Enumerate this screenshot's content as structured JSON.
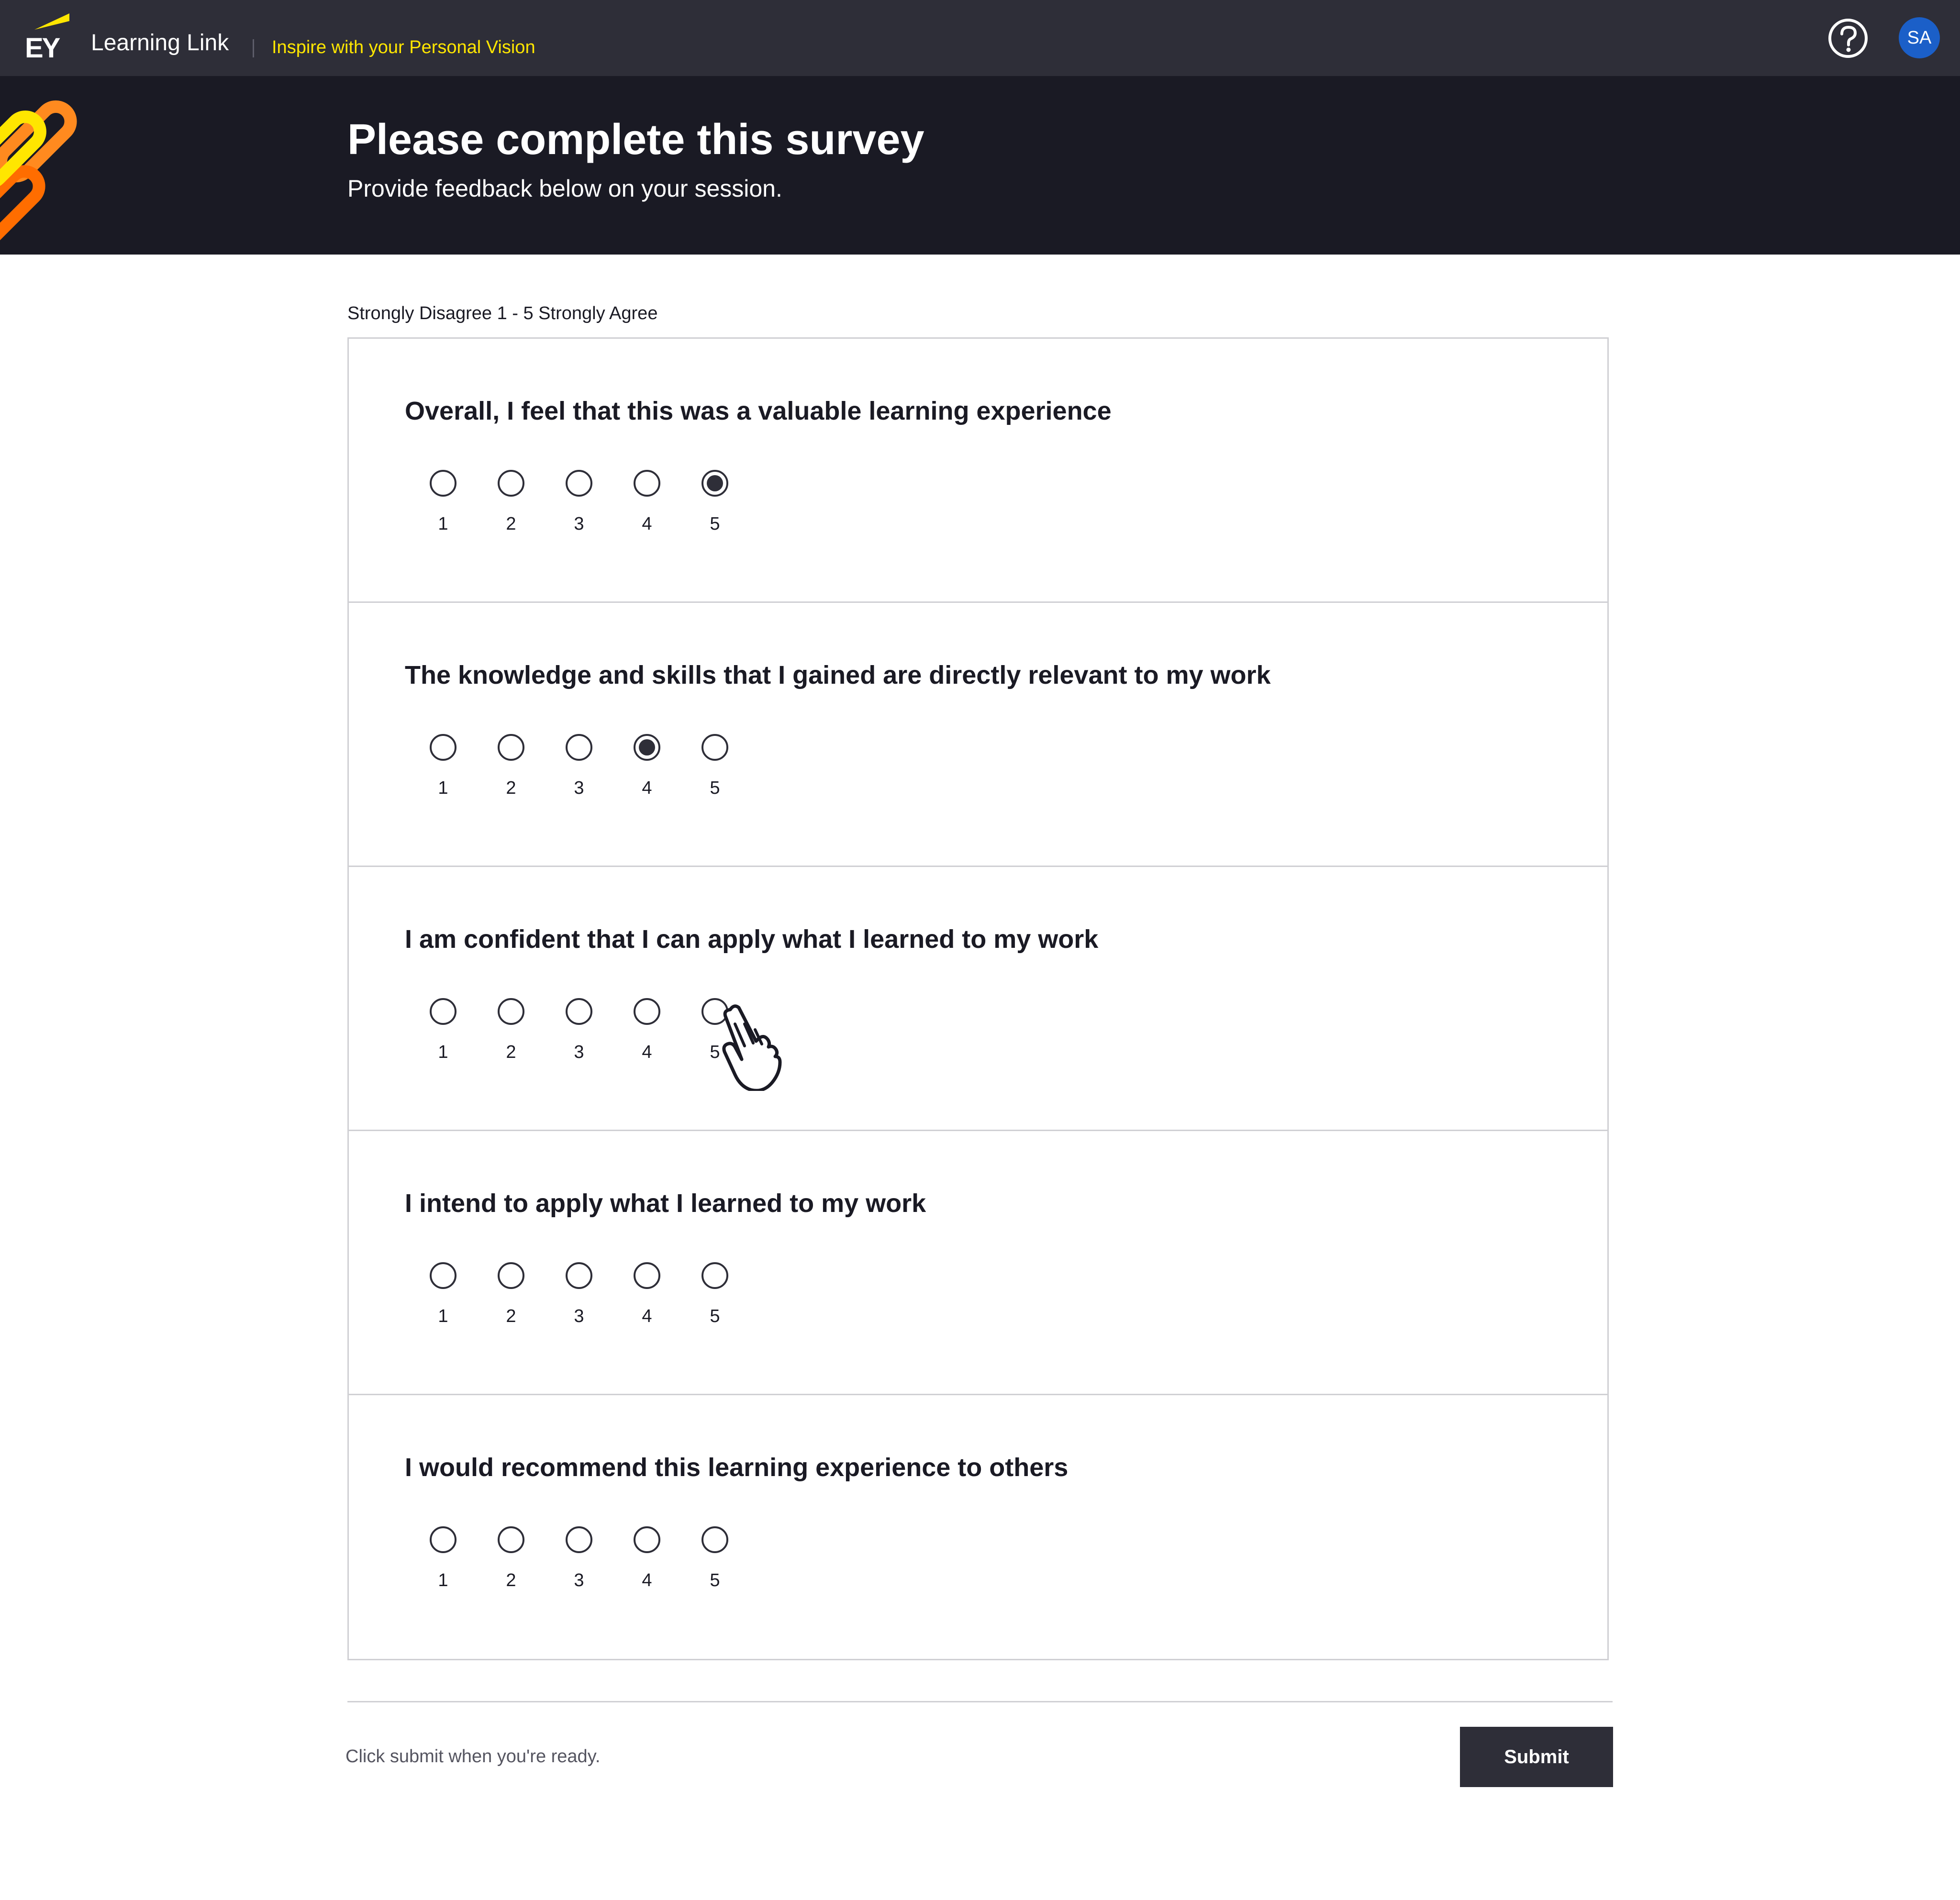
{
  "header": {
    "brand_logo_text": "EY",
    "app_name": "Learning Link",
    "tagline": "Inspire with your Personal Vision",
    "help_icon": "question-circle-icon",
    "avatar_initials": "SA",
    "colors": {
      "bar": "#2e2e38",
      "tagline": "#ffe600",
      "avatar": "#1b5fc8"
    }
  },
  "hero": {
    "title": "Please complete this survey",
    "subtitle": "Provide feedback below on your session.",
    "background": "#1a1a24"
  },
  "survey": {
    "scale_note": "Strongly Disagree 1 - 5 Strongly Agree",
    "questions": [
      {
        "text": "Overall, I feel that this was a valuable learning experience",
        "options": [
          "1",
          "2",
          "3",
          "4",
          "5"
        ],
        "selected": "5"
      },
      {
        "text": "The knowledge and skills that I gained are directly relevant to my work",
        "options": [
          "1",
          "2",
          "3",
          "4",
          "5"
        ],
        "selected": "4"
      },
      {
        "text": "I am confident that I can apply what I learned to my work",
        "options": [
          "1",
          "2",
          "3",
          "4",
          "5"
        ],
        "selected": null
      },
      {
        "text": "I intend to apply what I learned to my work",
        "options": [
          "1",
          "2",
          "3",
          "4",
          "5"
        ],
        "selected": null
      },
      {
        "text": "I would recommend this learning experience to others",
        "options": [
          "1",
          "2",
          "3",
          "4",
          "5"
        ],
        "selected": null
      }
    ]
  },
  "footer": {
    "note": "Click submit when you're ready.",
    "submit_label": "Submit"
  },
  "cursor": {
    "icon": "hand-pointer-icon"
  }
}
